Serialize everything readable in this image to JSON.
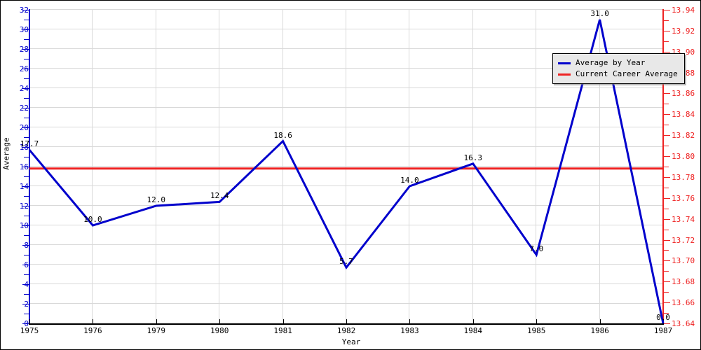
{
  "chart_data": {
    "type": "line",
    "title": "",
    "xlabel": "Year",
    "ylabel": "Average",
    "categories": [
      "1975",
      "1976",
      "1979",
      "1980",
      "1981",
      "1982",
      "1983",
      "1984",
      "1985",
      "1986",
      "1987"
    ],
    "series": [
      {
        "name": "Average by Year",
        "color": "#0000cc",
        "values": [
          17.7,
          10.0,
          12.0,
          12.4,
          18.6,
          5.7,
          14.0,
          16.3,
          7.0,
          31.0,
          0.0
        ],
        "point_labels": [
          "17.7",
          "10.0",
          "12.0",
          "12.4",
          "18.6",
          "5.7",
          "14.0",
          "16.3",
          "7.0",
          "31.0",
          "0.0"
        ]
      },
      {
        "name": "Current Career Average",
        "color": "#ee2222",
        "type": "hline",
        "value": 15.8
      }
    ],
    "ylim": [
      0,
      32
    ],
    "ytick_step": 2,
    "yticks": [
      "0",
      "2",
      "4",
      "6",
      "8",
      "10",
      "12",
      "14",
      "16",
      "18",
      "20",
      "22",
      "24",
      "26",
      "28",
      "30",
      "32"
    ],
    "y2lim": [
      13.64,
      13.94
    ],
    "y2tick_step": 0.02,
    "y2ticks": [
      "13.64",
      "13.66",
      "13.68",
      "13.70",
      "13.72",
      "13.74",
      "13.76",
      "13.78",
      "13.80",
      "13.82",
      "13.84",
      "13.86",
      "13.88",
      "13.90",
      "13.92",
      "13.94"
    ],
    "grid": true,
    "legend_position": "top-right",
    "axis_colors": {
      "left": "#0000cc",
      "right": "#ee2222",
      "bottom": "#000000",
      "grid": "#d9d9d9"
    }
  },
  "legend": {
    "entries": [
      {
        "label": "Average by Year",
        "color": "#0000cc"
      },
      {
        "label": "Current Career Average",
        "color": "#ee2222"
      }
    ]
  }
}
